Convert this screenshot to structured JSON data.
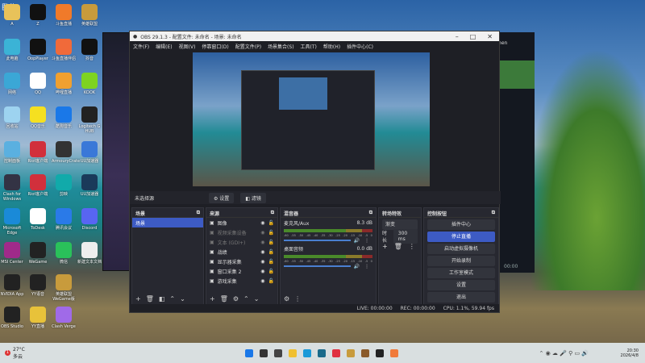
{
  "desktop": {
    "corner_text": "卧休",
    "icons": [
      {
        "label": "A",
        "color": "#e8c25a"
      },
      {
        "label": "Z",
        "color": "#111"
      },
      {
        "label": "斗鱼直播",
        "color": "#f07a2a"
      },
      {
        "label": "英雄联盟",
        "color": "#c89b3c"
      },
      {
        "label": "此电脑",
        "color": "#3bb3d6"
      },
      {
        "label": "OopPlayer",
        "color": "#111"
      },
      {
        "label": "斗鱼直播伴侣",
        "color": "#f06a3a"
      },
      {
        "label": "抖音",
        "color": "#111"
      },
      {
        "label": "网络",
        "color": "#3ba7d6"
      },
      {
        "label": "QQ",
        "color": "#fff"
      },
      {
        "label": "哔哩直播",
        "color": "#f0a030"
      },
      {
        "label": "KOOK",
        "color": "#7ed321"
      },
      {
        "label": "回收站",
        "color": "#9dd3f0"
      },
      {
        "label": "QQ音乐",
        "color": "#f5e020"
      },
      {
        "label": "酷狗音乐",
        "color": "#1a78e8"
      },
      {
        "label": "Logitech G HUB",
        "color": "#222"
      },
      {
        "label": "控制面板",
        "color": "#5ab0e0"
      },
      {
        "label": "Riot客户端",
        "color": "#d1303c"
      },
      {
        "label": "ArmouryCrate",
        "color": "#333"
      },
      {
        "label": "UU加速器",
        "color": "#3a78d8"
      },
      {
        "label": "Clash for Windows",
        "color": "#334"
      },
      {
        "label": "Riot客户端",
        "color": "#d1303c"
      },
      {
        "label": "剪映",
        "color": "#1aa"
      },
      {
        "label": "UU加速器",
        "color": "#1a3a5a"
      },
      {
        "label": "Microsoft Edge",
        "color": "#1a8ad8"
      },
      {
        "label": "ToDesk",
        "color": "#fff"
      },
      {
        "label": "腾讯会议",
        "color": "#2a7ae8"
      },
      {
        "label": "Discord",
        "color": "#5865f2"
      },
      {
        "label": "MSI Center",
        "color": "#a02a8a"
      },
      {
        "label": "WeGame",
        "color": "#222"
      },
      {
        "label": "微信",
        "color": "#2ac15a"
      },
      {
        "label": "新建文本文档",
        "color": "#eee"
      },
      {
        "label": "NVIDIA App",
        "color": "#222"
      },
      {
        "label": "YY语音",
        "color": "#222"
      },
      {
        "label": "英雄联盟WeGame版",
        "color": "#c89b3c"
      },
      {
        "label": "OBS Studio",
        "color": "#222"
      },
      {
        "label": "YY直播",
        "color": "#e8c23a"
      },
      {
        "label": "Clash Verge",
        "color": "#a06ae8"
      }
    ]
  },
  "obs": {
    "title": "OBS 29.1.3 - 配置文件: 未命名 - 场景: 未命名",
    "menu": [
      "文件(F)",
      "编辑(E)",
      "视图(V)",
      "停靠窗口(D)",
      "配置文件(P)",
      "场景集合(S)",
      "工具(T)",
      "帮助(H)",
      "插件中心(C)"
    ],
    "source_bar": {
      "label": "未选择源",
      "properties": "设置",
      "filters": "滤镜"
    },
    "scenes": {
      "title": "场景",
      "items": [
        "场景"
      ]
    },
    "sources": {
      "title": "来源",
      "items": [
        {
          "name": "图像",
          "visible": true
        },
        {
          "name": "视频采集设备",
          "visible": false
        },
        {
          "name": "文本 (GDI+)",
          "visible": false
        },
        {
          "name": "战绩",
          "visible": true
        },
        {
          "name": "显示器采集",
          "visible": true
        },
        {
          "name": "窗口采集 2",
          "visible": true
        },
        {
          "name": "游戏采集",
          "visible": true
        }
      ]
    },
    "mixer": {
      "title": "混音器",
      "channels": [
        {
          "name": "麦克风/Aux",
          "db": "8.3 dB"
        },
        {
          "name": "桌面音频",
          "db": "0.0 dB"
        }
      ],
      "ticks": [
        "-60",
        "-55",
        "-50",
        "-45",
        "-40",
        "-35",
        "-30",
        "-25",
        "-20",
        "-15",
        "-10",
        "-5",
        "0"
      ]
    },
    "transitions": {
      "title": "转场特效",
      "type": "渐变",
      "duration_label": "时长",
      "duration": "300 ms"
    },
    "controls": {
      "title": "控制按钮",
      "buttons": [
        "插件中心",
        "停止直播",
        "启动虚拟摄像机",
        "开始录制",
        "工作室模式",
        "设置",
        "退出"
      ]
    },
    "status": {
      "live": "LIVE: 00:00:00",
      "rec": "REC: 00:00:00",
      "cpu": "CPU: 1.1%, 59.94 fps"
    }
  },
  "friends": {
    "name": "...chen",
    "time": "00:00"
  },
  "taskbar": {
    "weather_temp": "27°C",
    "weather_desc": "多云",
    "time": "20:30",
    "date": "2026/4/8",
    "badge": "1",
    "apps": [
      "#1a78e8",
      "#333",
      "#444",
      "#f0c030",
      "#1a9ad8",
      "#1a6a8a",
      "#e03040",
      "#c89b3c",
      "#8a5a2a",
      "#222",
      "#f07a3a"
    ]
  }
}
